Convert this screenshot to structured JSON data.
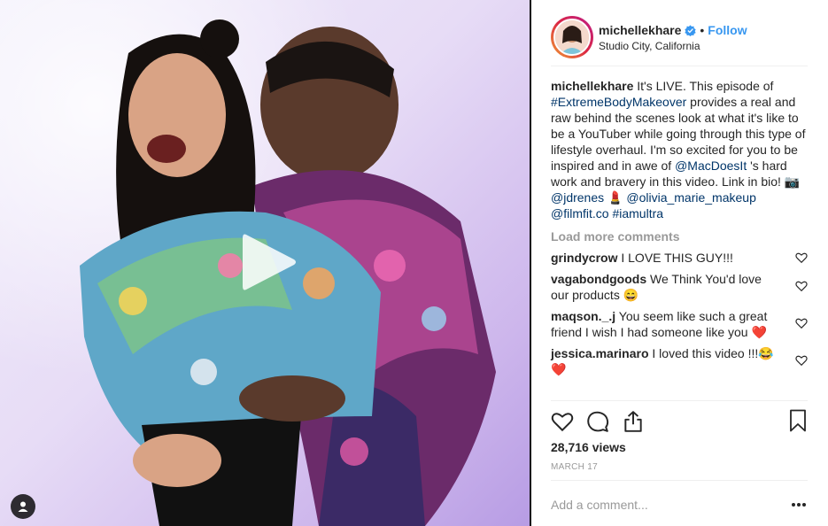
{
  "post": {
    "username": "michellekhare",
    "separator": "•",
    "follow_label": "Follow",
    "location": "Studio City, California",
    "caption": {
      "username": "michellekhare",
      "t1": " It's LIVE. This episode of ",
      "hashtag1": "#ExtremeBodyMakeover",
      "t2": " provides a real and raw behind the scenes look at what it's like to be a YouTuber while going through this type of lifestyle overhaul. I'm so excited for you to be inspired and in awe of ",
      "mention1": "@MacDoesIt",
      "t3": " 's hard work and bravery in this video. Link in bio! 📷",
      "mention2": "@jdrenes",
      "t4": " 💄 ",
      "mention3": "@olivia_marie_makeup",
      "mention4": "@filmfit.co",
      "hashtag2": "#iamultra"
    },
    "load_more": "Load more comments",
    "comments": [
      {
        "user": "grindycrow",
        "text": " I LOVE THIS GUY!!!"
      },
      {
        "user": "vagabondgoods",
        "text": " We Think You'd love our products 😄"
      },
      {
        "user": "maqson._.j",
        "text": " You seem like such a great friend I wish I had someone like you ❤️"
      },
      {
        "user": "jessica.marinaro",
        "text": " I loved this video !!!😂 ❤️"
      }
    ],
    "views": "28,716 views",
    "date": "MARCH 17",
    "comment_placeholder": "Add a comment..."
  },
  "icons": {
    "verified": "verified-badge-icon",
    "play": "play-icon",
    "profile_tag": "user-tag-icon",
    "like": "heart-icon",
    "comment": "comment-icon",
    "share": "share-icon",
    "save": "bookmark-icon",
    "more": "more-options-icon"
  },
  "colors": {
    "link_blue": "#3897f0",
    "tag_blue": "#003569",
    "muted": "#999999",
    "verified": "#3897f0",
    "heart_red": "#ed4956"
  }
}
